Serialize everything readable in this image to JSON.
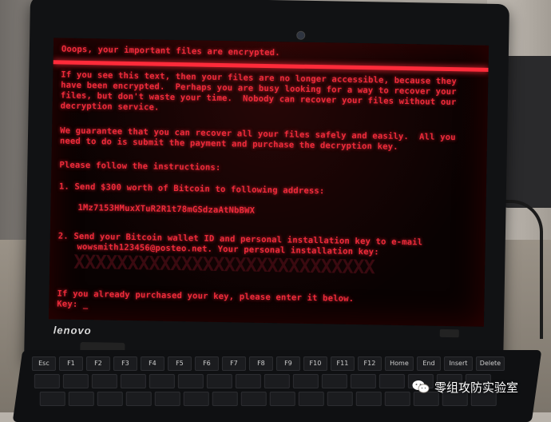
{
  "screen": {
    "lines": [
      "Ooops, your important files are encrypted.",
      "If you see this text, then your files are no longer accessible, because they",
      "have been encrypted.  Perhaps you are busy looking for a way to recover your",
      "files, but don't waste your time.  Nobody can recover your files without our",
      "decryption service.",
      "We guarantee that you can recover all your files safely and easily.  All you",
      "need to do is submit the payment and purchase the decryption key.",
      "Please follow the instructions:",
      "1. Send $300 worth of Bitcoin to following address:",
      "1Mz7153HMuxXTuR2R1t78mGSdzaAtNbBWX",
      "2. Send your Bitcoin wallet ID and personal installation key to e-mail",
      "wowsmith123456@posteo.net. Your personal installation key:",
      "If you already purchased your key, please enter it below.",
      "Key: _"
    ],
    "redacted_key": "XXXXXXXXXXXXXXXXXXXXXXXXXXXX"
  },
  "laptop": {
    "brand": "lenovo",
    "keys": [
      "Esc",
      "F1",
      "F2",
      "F3",
      "F4",
      "F5",
      "F6",
      "F7",
      "F8",
      "F9",
      "F10",
      "F11",
      "F12",
      "Home",
      "End",
      "Insert",
      "Delete"
    ]
  },
  "watermark": {
    "icon": "wechat-icon",
    "label": "零组攻防实验室"
  },
  "colors": {
    "screen_text": "#ee2b3a",
    "screen_bg": "#090202"
  }
}
